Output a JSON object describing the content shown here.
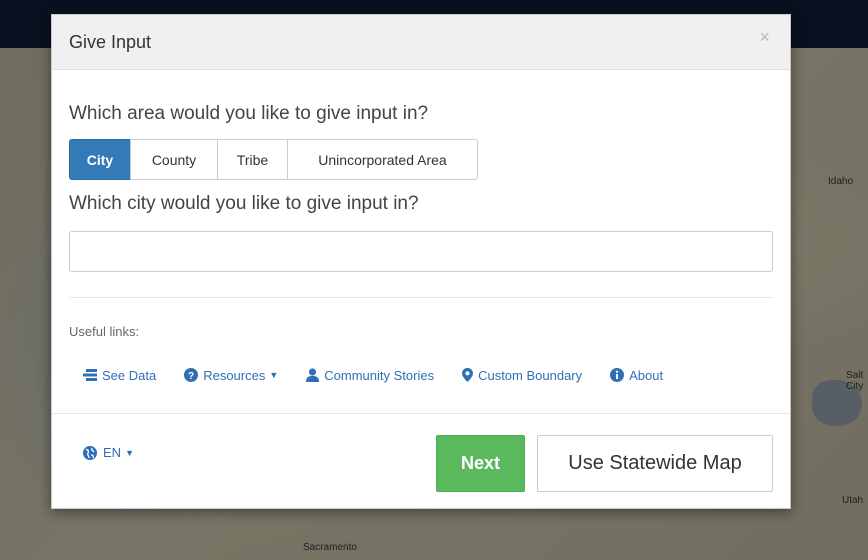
{
  "map": {
    "labels": [
      "Idaho",
      "Salt",
      "City",
      "Utah",
      "Sacramento"
    ]
  },
  "modal": {
    "title": "Give Input",
    "close": "×",
    "area_question": "Which area would you like to give input in?",
    "area_options": [
      "City",
      "County",
      "Tribe",
      "Unincorporated Area"
    ],
    "selected_area": "City",
    "city_question": "Which city would you like to give input in?",
    "city_input": {
      "value": "",
      "placeholder": ""
    },
    "useful_links_label": "Useful links:",
    "links": [
      {
        "label": "See Data",
        "icon": "data-table-icon"
      },
      {
        "label": "Resources",
        "icon": "question-circle-icon",
        "dropdown": true
      },
      {
        "label": "Community Stories",
        "icon": "user-icon"
      },
      {
        "label": "Custom Boundary",
        "icon": "map-marker-icon"
      },
      {
        "label": "About",
        "icon": "info-circle-icon"
      }
    ],
    "language": {
      "label": "EN",
      "icon": "globe-icon",
      "dropdown": true
    },
    "next_label": "Next",
    "statewide_label": "Use Statewide Map"
  },
  "colors": {
    "primary": "#337ab7",
    "link": "#2f6fb6",
    "success": "#5cb85c",
    "navbar": "#0f1a33"
  }
}
